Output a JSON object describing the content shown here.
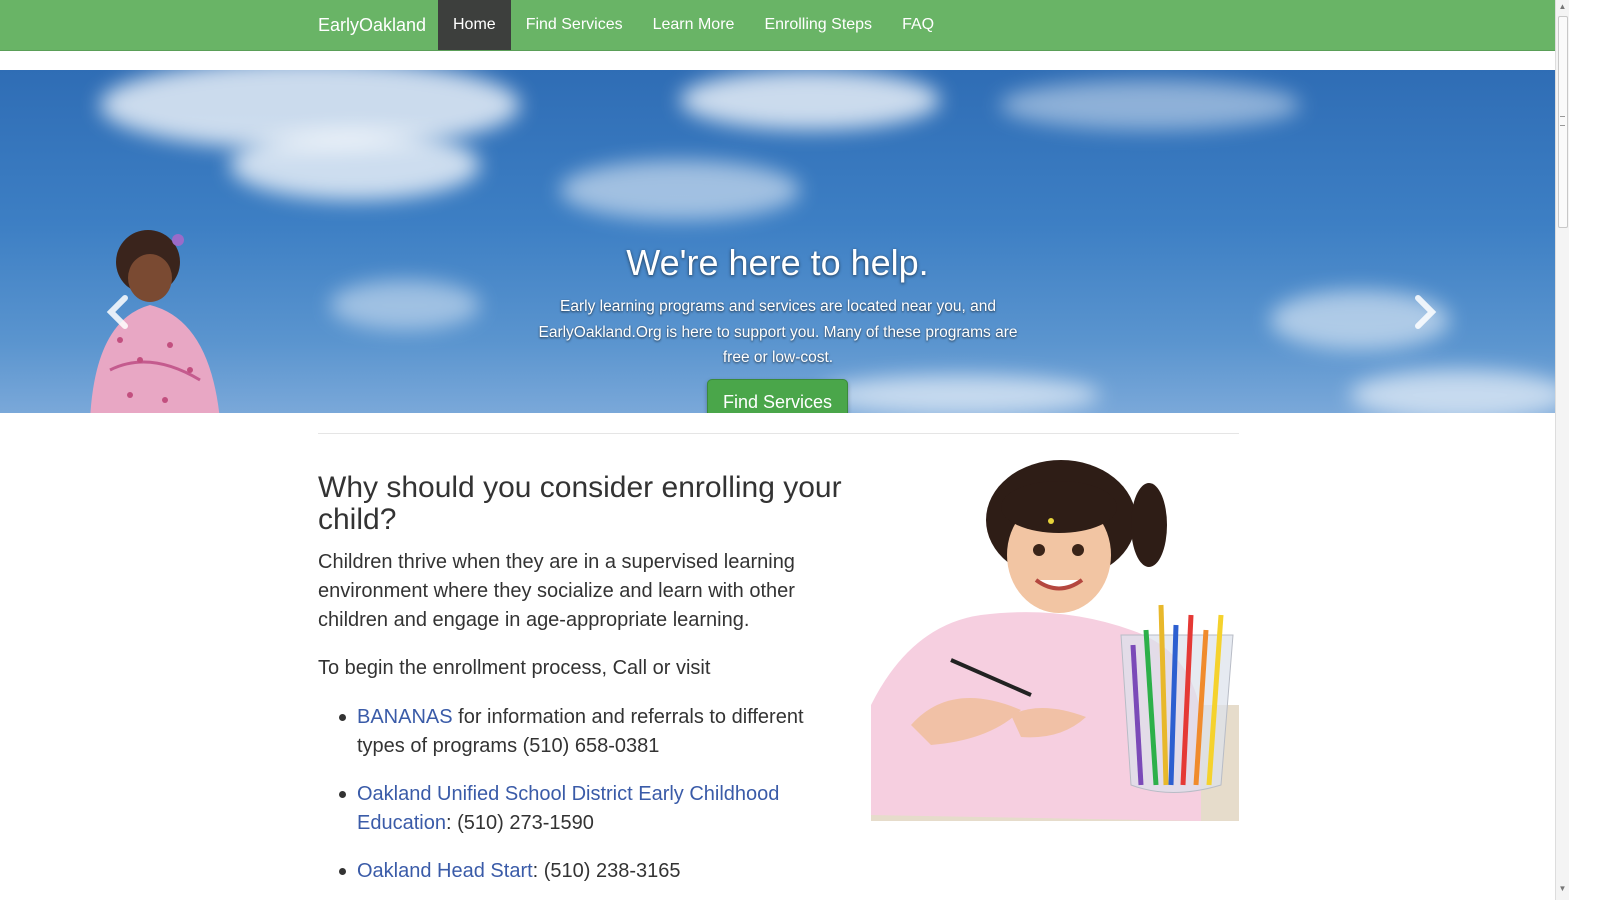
{
  "nav": {
    "brand": "EarlyOakland",
    "items": [
      {
        "label": "Home",
        "active": true
      },
      {
        "label": "Find Services",
        "active": false
      },
      {
        "label": "Learn More",
        "active": false
      },
      {
        "label": "Enrolling Steps",
        "active": false
      },
      {
        "label": "FAQ",
        "active": false
      }
    ],
    "color": "#69b466",
    "active_color": "#3d3f3d"
  },
  "hero": {
    "title": "We're here to help.",
    "text": "Early learning programs and services are located near you, and EarlyOakland.Org is here to support you. Many of these programs are free or low-cost.",
    "button_label": "Find Services",
    "slides_total": 3,
    "active_slide": 2,
    "button_color": "#4aa64a"
  },
  "main": {
    "heading": "Why should you consider enrolling your child?",
    "paragraph1": "Children thrive when they are in a supervised learning environment where they socialize and learn with other children and engage in age-appropriate learning.",
    "paragraph2": "To begin the enrollment process, Call or visit",
    "list": [
      {
        "link": "BANANAS",
        "text": " for information and referrals to different types of programs (510) 658-0381"
      },
      {
        "link": "Oakland Unified School District Early Childhood Education",
        "text": ": (510) 273-1590"
      },
      {
        "link": "Oakland Head Start",
        "text": ": (510) 238-3165"
      }
    ],
    "link_color": "#3a5ba8"
  }
}
